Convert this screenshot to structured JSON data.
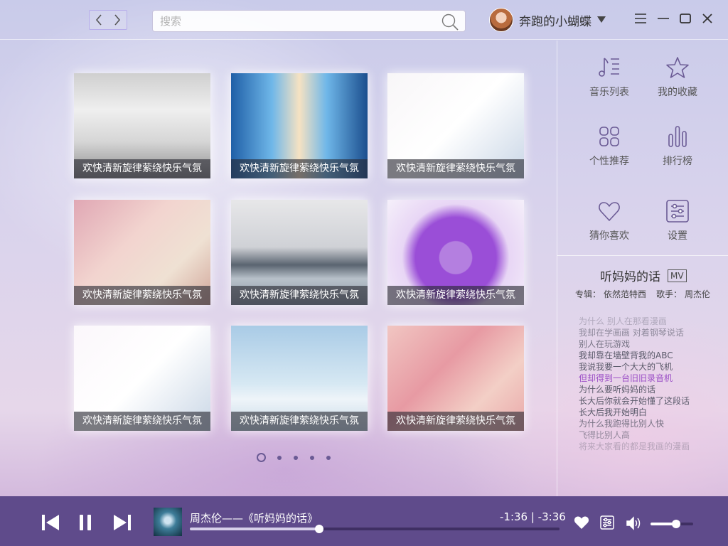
{
  "header": {
    "search_placeholder": "搜索",
    "username": "奔跑的小蝴蝶"
  },
  "albums": [
    {
      "caption": "欢快清新旋律萦绕快乐气氛"
    },
    {
      "caption": "欢快清新旋律萦绕快乐气氛"
    },
    {
      "caption": "欢快清新旋律萦绕快乐气氛"
    },
    {
      "caption": "欢快清新旋律萦绕快乐气氛"
    },
    {
      "caption": "欢快清新旋律萦绕快乐气氛"
    },
    {
      "caption": "欢快清新旋律萦绕快乐气氛"
    },
    {
      "caption": "欢快清新旋律萦绕快乐气氛"
    },
    {
      "caption": "欢快清新旋律萦绕快乐气氛"
    },
    {
      "caption": "欢快清新旋律萦绕快乐气氛"
    }
  ],
  "pagination": {
    "pages": 5,
    "current": 1
  },
  "side_menu": [
    {
      "label": "音乐列表",
      "icon": "music-list-icon"
    },
    {
      "label": "我的收藏",
      "icon": "star-icon"
    },
    {
      "label": "个性推荐",
      "icon": "grid-icon"
    },
    {
      "label": "排行榜",
      "icon": "bar-chart-icon"
    },
    {
      "label": "猜你喜欢",
      "icon": "heart-icon"
    },
    {
      "label": "设置",
      "icon": "settings-icon"
    }
  ],
  "now_playing_info": {
    "title": "听妈妈的话",
    "mv_badge": "MV",
    "album_label": "专辑：",
    "album": "依然范特西",
    "singer_label": "歌手：",
    "singer": "周杰伦"
  },
  "lyrics": [
    {
      "text": "为什么 别人在那看漫画",
      "current": false
    },
    {
      "text": "我却在学画画 对着钢琴说话",
      "current": false
    },
    {
      "text": "别人在玩游戏",
      "current": false
    },
    {
      "text": "我却靠在墙壁背我的ABC",
      "current": false
    },
    {
      "text": "我说我要一个大大的飞机",
      "current": false
    },
    {
      "text": "但却得到一台旧旧录音机",
      "current": true
    },
    {
      "text": "为什么要听妈妈的话",
      "current": false
    },
    {
      "text": "长大后你就会开始懂了这段话",
      "current": false
    },
    {
      "text": "长大后我开始明白",
      "current": false
    },
    {
      "text": "为什么我跑得比别人快",
      "current": false
    },
    {
      "text": "飞得比别人高",
      "current": false
    },
    {
      "text": "将来大家看的都是我画的漫画",
      "current": false
    }
  ],
  "player": {
    "track": "周杰伦——《听妈妈的话》",
    "time": "-1:36 | -3:36",
    "progress": 0.35,
    "volume": 0.6
  },
  "colors": {
    "accent": "#9b4fc6",
    "player_bg": "#5f4b8b",
    "icon": "#6a5a94"
  }
}
